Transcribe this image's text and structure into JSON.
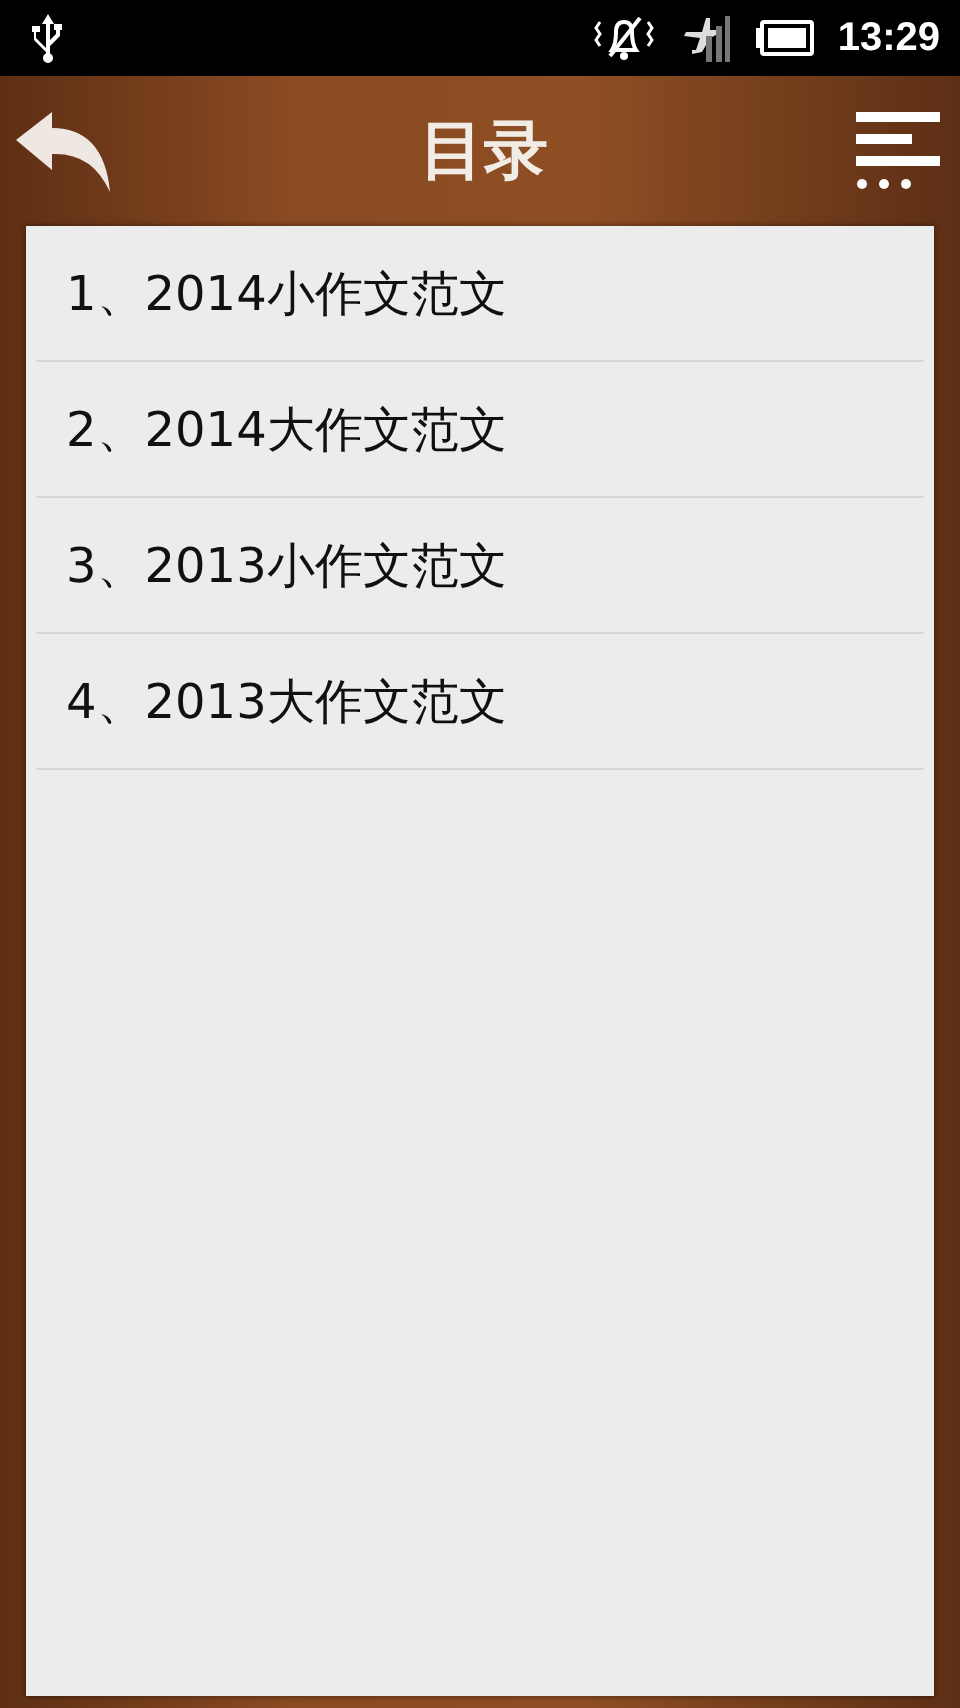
{
  "status_bar": {
    "time": "13:29"
  },
  "header": {
    "title": "目录"
  },
  "items": [
    {
      "label": "1、2014小作文范文"
    },
    {
      "label": "2、2014大作文范文"
    },
    {
      "label": "3、2013小作文范文"
    },
    {
      "label": "4、2013大作文范文"
    }
  ]
}
